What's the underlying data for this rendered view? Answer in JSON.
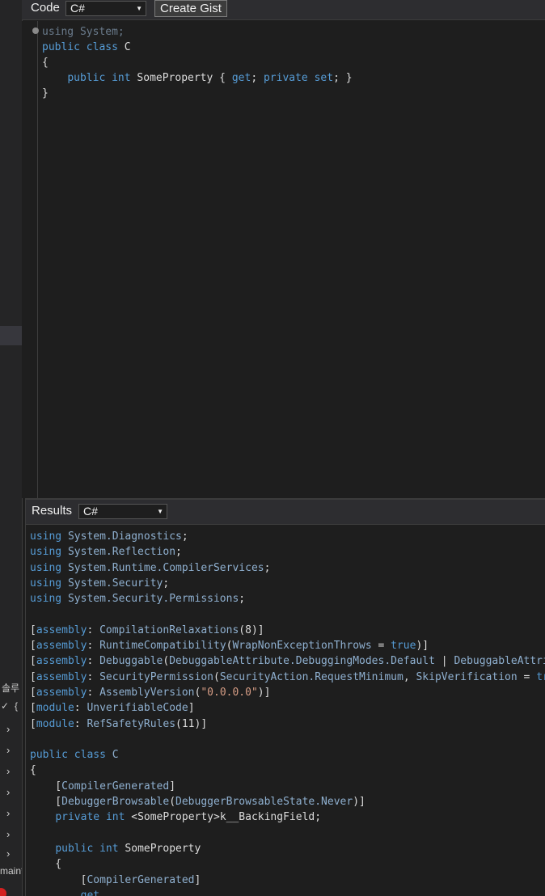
{
  "left_panel": {
    "korean_label": "솔루",
    "main_label": "main*",
    "brace": "{"
  },
  "editor": {
    "label": "Code",
    "language": "C#",
    "create_gist_label": "Create Gist",
    "lines": [
      [
        {
          "t": "using System;",
          "c": "dim"
        }
      ],
      [
        {
          "t": "public",
          "c": "kw"
        },
        {
          "t": " "
        },
        {
          "t": "class",
          "c": "kw"
        },
        {
          "t": " C"
        }
      ],
      [
        {
          "t": "{"
        }
      ],
      [
        {
          "t": "    "
        },
        {
          "t": "public",
          "c": "kw"
        },
        {
          "t": " "
        },
        {
          "t": "int",
          "c": "kw"
        },
        {
          "t": " SomeProperty { "
        },
        {
          "t": "get",
          "c": "kw"
        },
        {
          "t": "; "
        },
        {
          "t": "private",
          "c": "kw"
        },
        {
          "t": " "
        },
        {
          "t": "set",
          "c": "kw"
        },
        {
          "t": "; }"
        }
      ],
      [
        {
          "t": "}"
        }
      ]
    ]
  },
  "results": {
    "label": "Results",
    "language": "C#",
    "lines": [
      [
        {
          "t": "using",
          "c": "kw"
        },
        {
          "t": " "
        },
        {
          "t": "System.Diagnostics",
          "c": "rlink"
        },
        {
          "t": ";"
        }
      ],
      [
        {
          "t": "using",
          "c": "kw"
        },
        {
          "t": " "
        },
        {
          "t": "System.Reflection",
          "c": "rlink"
        },
        {
          "t": ";"
        }
      ],
      [
        {
          "t": "using",
          "c": "kw"
        },
        {
          "t": " "
        },
        {
          "t": "System.Runtime.CompilerServices",
          "c": "rlink"
        },
        {
          "t": ";"
        }
      ],
      [
        {
          "t": "using",
          "c": "kw"
        },
        {
          "t": " "
        },
        {
          "t": "System.Security",
          "c": "rlink"
        },
        {
          "t": ";"
        }
      ],
      [
        {
          "t": "using",
          "c": "kw"
        },
        {
          "t": " "
        },
        {
          "t": "System.Security.Permissions",
          "c": "rlink"
        },
        {
          "t": ";"
        }
      ],
      [],
      [
        {
          "t": "["
        },
        {
          "t": "assembly",
          "c": "kw"
        },
        {
          "t": ": "
        },
        {
          "t": "CompilationRelaxations",
          "c": "rlink"
        },
        {
          "t": "(8)]"
        }
      ],
      [
        {
          "t": "["
        },
        {
          "t": "assembly",
          "c": "kw"
        },
        {
          "t": ": "
        },
        {
          "t": "RuntimeCompatibility",
          "c": "rlink"
        },
        {
          "t": "("
        },
        {
          "t": "WrapNonExceptionThrows",
          "c": "rlink"
        },
        {
          "t": " = "
        },
        {
          "t": "true",
          "c": "kw"
        },
        {
          "t": ")]"
        }
      ],
      [
        {
          "t": "["
        },
        {
          "t": "assembly",
          "c": "kw"
        },
        {
          "t": ": "
        },
        {
          "t": "Debuggable",
          "c": "rlink"
        },
        {
          "t": "("
        },
        {
          "t": "DebuggableAttribute.DebuggingModes.Default",
          "c": "rlink"
        },
        {
          "t": " | "
        },
        {
          "t": "DebuggableAttribute.DebuggingModes.DisableOptimizations",
          "c": "rlink"
        },
        {
          "t": ")]"
        }
      ],
      [
        {
          "t": "["
        },
        {
          "t": "assembly",
          "c": "kw"
        },
        {
          "t": ": "
        },
        {
          "t": "SecurityPermission",
          "c": "rlink"
        },
        {
          "t": "("
        },
        {
          "t": "SecurityAction.RequestMinimum",
          "c": "rlink"
        },
        {
          "t": ", "
        },
        {
          "t": "SkipVerification",
          "c": "rlink"
        },
        {
          "t": " = "
        },
        {
          "t": "true",
          "c": "kw"
        },
        {
          "t": ")]"
        }
      ],
      [
        {
          "t": "["
        },
        {
          "t": "assembly",
          "c": "kw"
        },
        {
          "t": ": "
        },
        {
          "t": "AssemblyVersion",
          "c": "rlink"
        },
        {
          "t": "("
        },
        {
          "t": "\"0.0.0.0\"",
          "c": "str"
        },
        {
          "t": ")]"
        }
      ],
      [
        {
          "t": "["
        },
        {
          "t": "module",
          "c": "kw"
        },
        {
          "t": ": "
        },
        {
          "t": "UnverifiableCode",
          "c": "rlink"
        },
        {
          "t": "]"
        }
      ],
      [
        {
          "t": "["
        },
        {
          "t": "module",
          "c": "kw"
        },
        {
          "t": ": "
        },
        {
          "t": "RefSafetyRules",
          "c": "rlink"
        },
        {
          "t": "(11)]"
        }
      ],
      [],
      [
        {
          "t": "public",
          "c": "kw"
        },
        {
          "t": " "
        },
        {
          "t": "class",
          "c": "kw"
        },
        {
          "t": " "
        },
        {
          "t": "C",
          "c": "rlink"
        }
      ],
      [
        {
          "t": "{"
        }
      ],
      [
        {
          "t": "    ["
        },
        {
          "t": "CompilerGenerated",
          "c": "rlink"
        },
        {
          "t": "]"
        }
      ],
      [
        {
          "t": "    ["
        },
        {
          "t": "DebuggerBrowsable",
          "c": "rlink"
        },
        {
          "t": "("
        },
        {
          "t": "DebuggerBrowsableState.Never",
          "c": "rlink"
        },
        {
          "t": ")]"
        }
      ],
      [
        {
          "t": "    "
        },
        {
          "t": "private",
          "c": "kw"
        },
        {
          "t": " "
        },
        {
          "t": "int",
          "c": "kw"
        },
        {
          "t": " <SomeProperty>k__BackingField;"
        }
      ],
      [],
      [
        {
          "t": "    "
        },
        {
          "t": "public",
          "c": "kw"
        },
        {
          "t": " "
        },
        {
          "t": "int",
          "c": "kw"
        },
        {
          "t": " SomeProperty"
        }
      ],
      [
        {
          "t": "    {"
        }
      ],
      [
        {
          "t": "        ["
        },
        {
          "t": "CompilerGenerated",
          "c": "rlink"
        },
        {
          "t": "]"
        }
      ],
      [
        {
          "t": "        "
        },
        {
          "t": "get",
          "c": "kw"
        }
      ]
    ]
  }
}
